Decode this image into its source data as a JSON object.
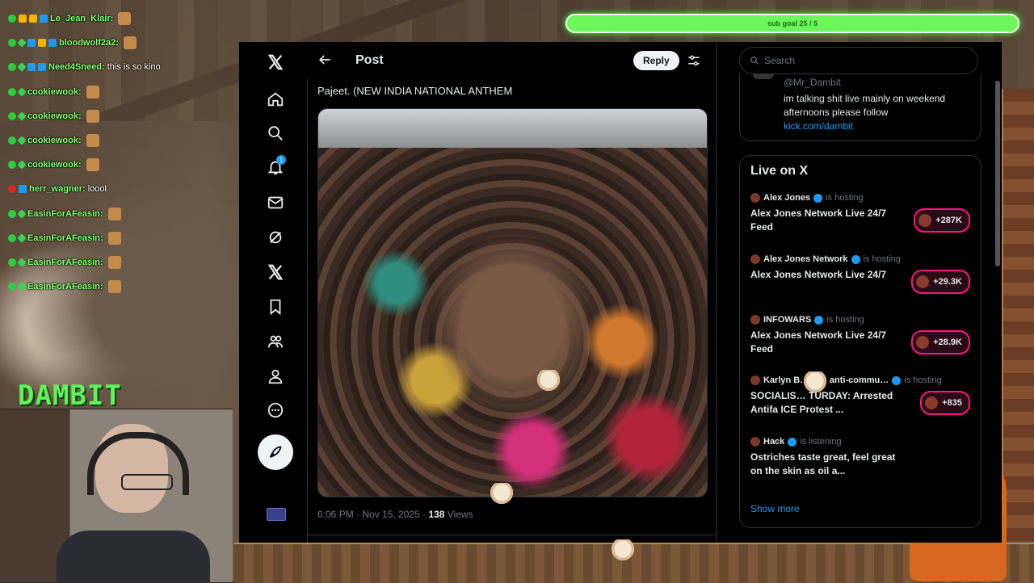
{
  "chat": [
    {
      "name": "Le_Jean_Klair:",
      "message": "",
      "badges": [
        "green",
        "gold",
        "gold",
        "blue"
      ]
    },
    {
      "name": "bloodwolf2a2:",
      "message": "",
      "badges": [
        "green",
        "cross",
        "blue",
        "gold",
        "blue"
      ]
    },
    {
      "name": "Need4Sneed:",
      "message": "this is so kino",
      "badges": [
        "green",
        "cross",
        "blue",
        "blue"
      ]
    },
    {
      "name": "cookiewook:",
      "message": "",
      "badges": [
        "green",
        "cross"
      ]
    },
    {
      "name": "cookiewook:",
      "message": "",
      "badges": [
        "green",
        "cross"
      ]
    },
    {
      "name": "cookiewook:",
      "message": "",
      "badges": [
        "green",
        "cross"
      ]
    },
    {
      "name": "cookiewook:",
      "message": "",
      "badges": [
        "green",
        "cross"
      ]
    },
    {
      "name": "herr_wagner:",
      "message": "loool",
      "badges": [
        "red",
        "blue"
      ]
    },
    {
      "name": "EasinForAFeasin:",
      "message": "",
      "badges": [
        "green",
        "cross"
      ]
    },
    {
      "name": "EasinForAFeasin:",
      "message": "",
      "badges": [
        "green",
        "cross"
      ]
    },
    {
      "name": "EasinForAFeasin:",
      "message": "",
      "badges": [
        "green",
        "cross"
      ]
    },
    {
      "name": "EasinForAFeasin:",
      "message": "",
      "badges": [
        "green",
        "cross"
      ]
    }
  ],
  "overlay": {
    "logo_text": "DAMBIT",
    "subgoal_text": "sub goal 25 / 5"
  },
  "nav": {
    "icons": [
      "x-logo-icon",
      "home-icon",
      "search-icon",
      "notifications-icon",
      "messages-icon",
      "grok-icon",
      "x-premium-icon",
      "bookmarks-icon",
      "communities-icon",
      "profile-icon",
      "more-icon"
    ],
    "notification_count": "1"
  },
  "post": {
    "header_title": "Post",
    "reply_label": "Reply",
    "text": "Pajeet. (NEW INDIA NATIONAL ANTHEM",
    "time": "6:06 PM · Nov 15, 2025 · ",
    "views_count": "138",
    "views_label": " Views"
  },
  "sidebar": {
    "search_placeholder": "Search",
    "profile_handle": "@Mr_Dambit",
    "profile_bio": "im talking shit live mainly on weekend afternoons please follow",
    "profile_link": "kick.com/dambit",
    "live_title": "Live on X",
    "live_items": [
      {
        "host": "Alex Jones",
        "status": "is hosting",
        "title": "Alex Jones Network Live 24/7 Feed",
        "count": "+287K"
      },
      {
        "host": "Alex Jones Network",
        "status": "is hosting",
        "title": "Alex Jones Network Live 24/7",
        "count": "+29.3K"
      },
      {
        "host": "INFOWARS",
        "status": "is hosting",
        "title": "Alex Jones Network Live 24/7 Feed",
        "count": "+28.9K"
      },
      {
        "host": "Karlyn B…nko, anti-commu…",
        "status": "is hosting",
        "title": "SOCIALIS… TURDAY: Arrested Antifa ICE Protest ...",
        "count": "+835"
      },
      {
        "host": "Hack",
        "status": "is listening",
        "title": "Ostriches taste great, feel great on the skin as oil a...",
        "count": ""
      }
    ],
    "show_more": "Show more"
  },
  "colors": {
    "accent": "#1d9bf0",
    "live_pill": "#f91880",
    "subgoal": "#6cf75a",
    "chat_name": "#7dff6a"
  }
}
